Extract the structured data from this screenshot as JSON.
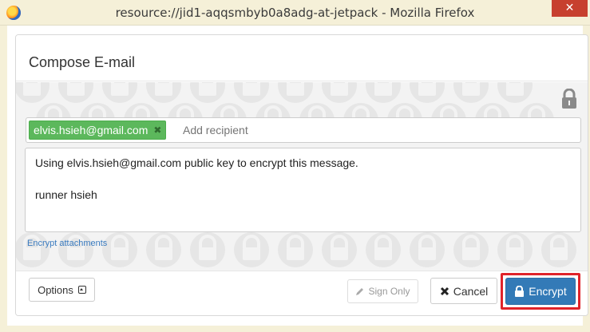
{
  "window": {
    "title": "resource://jid1-aqqsmbyb0a8adg-at-jetpack - Mozilla Firefox",
    "close_glyph": "✕",
    "app_icon": "firefox-icon"
  },
  "dialog": {
    "title": "Compose E-mail",
    "recipients": [
      {
        "email": "elvis.hsieh@gmail.com",
        "remove_glyph": "✖",
        "color": "#5cb85c"
      }
    ],
    "add_recipient_placeholder": "Add recipient",
    "message_lines": [
      "Using elvis.hsieh@gmail.com public key to encrypt this message.",
      "",
      "runner hsieh"
    ],
    "encrypt_attachments_link": "Encrypt attachments",
    "lock_icon": "lock-icon"
  },
  "footer": {
    "options_label": "Options",
    "sign_only_label": "Sign Only",
    "cancel_label": "Cancel",
    "encrypt_label": "Encrypt",
    "encrypt_color": "#337ab7",
    "highlight_color": "#e0232a"
  }
}
